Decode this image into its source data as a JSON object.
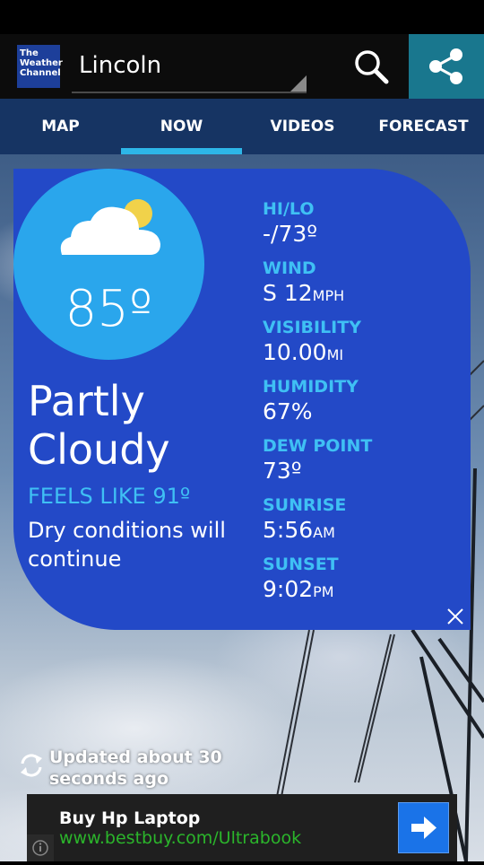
{
  "app": {
    "logo_lines": [
      "The",
      "Weather",
      "Channel"
    ],
    "city": "Lincoln"
  },
  "tabs": [
    {
      "label": "MAP",
      "active": false
    },
    {
      "label": "NOW",
      "active": true
    },
    {
      "label": "VIDEOS",
      "active": false
    },
    {
      "label": "FORECAST",
      "active": false
    }
  ],
  "current": {
    "temperature": "85º",
    "condition": "Partly Cloudy",
    "feels_like": "FEELS LIKE 91º",
    "summary": "Dry conditions will continue",
    "icon": "partly-cloudy-icon"
  },
  "stats": {
    "hilo": {
      "label": "HI/LO",
      "value": "-/73º"
    },
    "wind": {
      "label": "WIND",
      "value": "S 12",
      "unit": "MPH"
    },
    "visibility": {
      "label": "VISIBILITY",
      "value": "10.00",
      "unit": "MI"
    },
    "humidity": {
      "label": "HUMIDITY",
      "value": "67%"
    },
    "dew_point": {
      "label": "DEW POINT",
      "value": "73º"
    },
    "sunrise": {
      "label": "SUNRISE",
      "value": "5:56",
      "unit": "AM"
    },
    "sunset": {
      "label": "SUNSET",
      "value": "9:02",
      "unit": "PM"
    }
  },
  "status": {
    "updated": "Updated about 30 seconds ago"
  },
  "ad": {
    "title": "Buy Hp Laptop",
    "url": "www.bestbuy.com/Ultrabook"
  },
  "colors": {
    "card": "#2349c7",
    "accent": "#3fc0f4",
    "tab_bar": "#163463",
    "share": "#19778e"
  }
}
